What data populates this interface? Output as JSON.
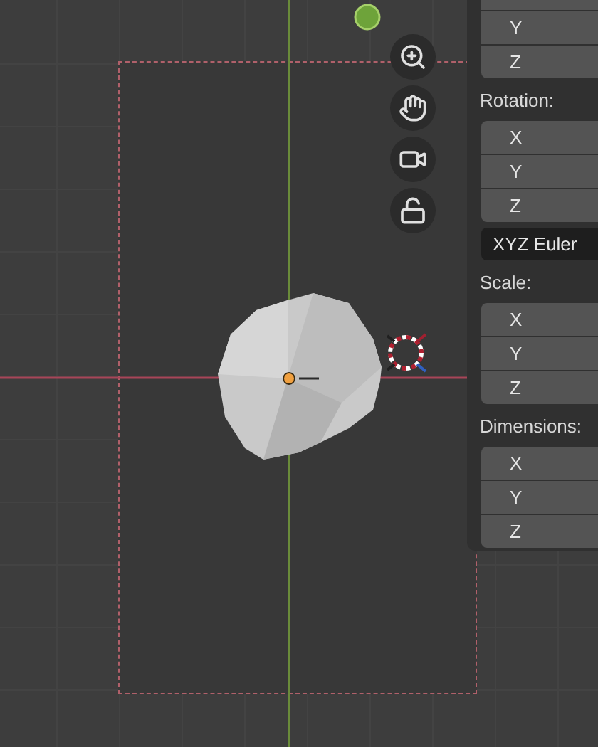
{
  "properties_panel": {
    "sections": [
      {
        "fields": [
          {
            "label": "Y"
          },
          {
            "label": "Z"
          }
        ]
      },
      {
        "heading": "Rotation:",
        "fields": [
          {
            "label": "X"
          },
          {
            "label": "Y"
          },
          {
            "label": "Z"
          }
        ],
        "mode": "XYZ Euler"
      },
      {
        "heading": "Scale:",
        "fields": [
          {
            "label": "X"
          },
          {
            "label": "Y"
          },
          {
            "label": "Z"
          }
        ]
      },
      {
        "heading": "Dimensions:",
        "fields": [
          {
            "label": "X"
          },
          {
            "label": "Y"
          },
          {
            "label": "Z"
          }
        ]
      }
    ]
  }
}
